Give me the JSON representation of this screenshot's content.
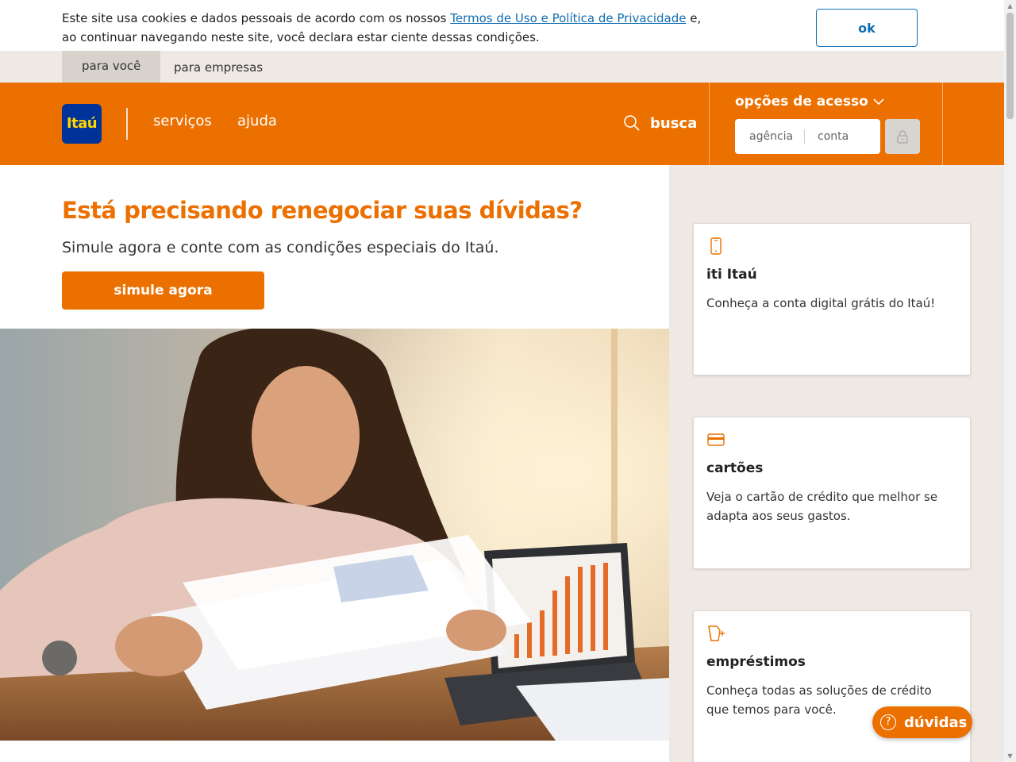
{
  "cookie": {
    "text_before": "Este site usa cookies e dados pessoais de acordo com os nossos ",
    "link": "Termos de Uso e Política de Privacidade",
    "text_after": " e, ao continuar navegando neste site, você declara estar ciente dessas condições.",
    "ok_label": "ok"
  },
  "segments": {
    "active": "para você",
    "other": "para empresas"
  },
  "header": {
    "logo": "Itaú",
    "nav": [
      "serviços",
      "ajuda"
    ],
    "search_label": "busca",
    "access_title": "opções de acesso",
    "agencia_placeholder": "agência",
    "conta_placeholder": "conta"
  },
  "hero": {
    "title": "Está precisando renegociar suas dívidas?",
    "subtitle": "Simule agora e conte com as condições especiais do Itaú.",
    "button": "simule agora"
  },
  "cards": [
    {
      "icon": "smartphone-icon",
      "title": "iti Itaú",
      "text": "Conheça a conta digital grátis do Itaú!"
    },
    {
      "icon": "credit-card-icon",
      "title": "cartões",
      "text": "Veja o cartão de crédito que melhor se adapta aos seus gastos."
    },
    {
      "icon": "loan-icon",
      "title": "empréstimos",
      "text": "Conheça todas as soluções de crédito que temos para você."
    }
  ],
  "help_button": "dúvidas",
  "colors": {
    "brand_orange": "#ec7000",
    "brand_blue": "#003399",
    "logo_yellow": "#ffd400",
    "link_blue": "#106eb0",
    "beige": "#efe9e5"
  }
}
